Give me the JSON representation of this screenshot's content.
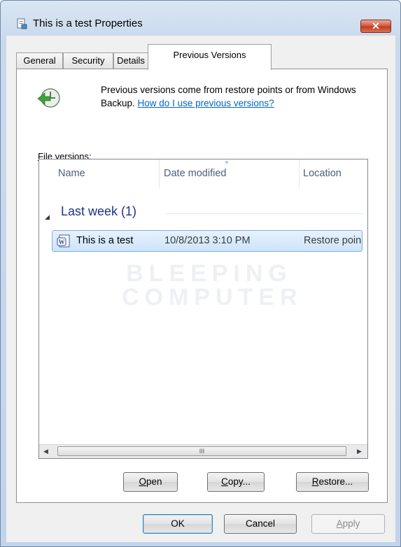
{
  "window": {
    "title": "This is a test Properties",
    "close_label": "✕"
  },
  "tabs": [
    {
      "label": "General",
      "active": false
    },
    {
      "label": "Security",
      "active": false
    },
    {
      "label": "Details",
      "active": false
    },
    {
      "label": "Previous Versions",
      "active": true
    }
  ],
  "info": {
    "text": "Previous versions come from restore points or from Windows Backup.",
    "link": "How do I use previous versions?"
  },
  "file_versions": {
    "label_prefix": "F",
    "label_rest": "ile versions:",
    "columns": [
      "Name",
      "Date modified",
      "Location"
    ],
    "groups": [
      {
        "title": "Last week (1)",
        "items": [
          {
            "name": "This is a test",
            "date_modified": "10/8/2013 3:10 PM",
            "location": "Restore poin"
          }
        ]
      }
    ],
    "scroll_thumb_glyph": "III",
    "watermark": [
      "BLEEPING",
      "COMPUTER"
    ]
  },
  "actions": {
    "open": {
      "u": "O",
      "rest": "pen"
    },
    "copy": {
      "u": "C",
      "rest": "opy..."
    },
    "restore": {
      "u": "R",
      "rest": "estore..."
    }
  },
  "dialog_buttons": {
    "ok": "OK",
    "cancel": "Cancel",
    "apply": {
      "u": "A",
      "rest": "pply"
    }
  }
}
